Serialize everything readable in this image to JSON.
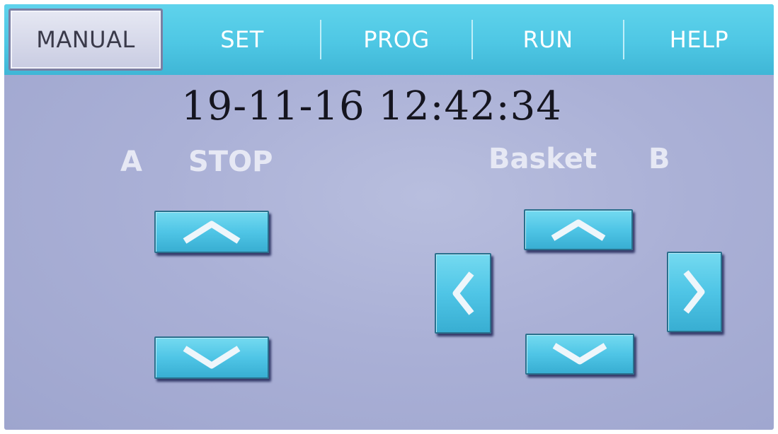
{
  "tabs": [
    {
      "label": "MANUAL",
      "active": true
    },
    {
      "label": "SET",
      "active": false
    },
    {
      "label": "PROG",
      "active": false
    },
    {
      "label": "RUN",
      "active": false
    },
    {
      "label": "HELP",
      "active": false
    }
  ],
  "datetime": "19-11-16 12:42:34",
  "left_panel": {
    "channel": "A",
    "status": "STOP"
  },
  "right_panel": {
    "label": "Basket",
    "channel": "B"
  },
  "icons": {
    "up": "chevron-up-icon",
    "down": "chevron-down-icon",
    "left": "chevron-left-icon",
    "right": "chevron-right-icon"
  },
  "colors": {
    "tab_bar": "#4ec7e4",
    "button": "#4fc5e6",
    "background": "#aab0d6",
    "label_text": "#e6e8f4"
  }
}
